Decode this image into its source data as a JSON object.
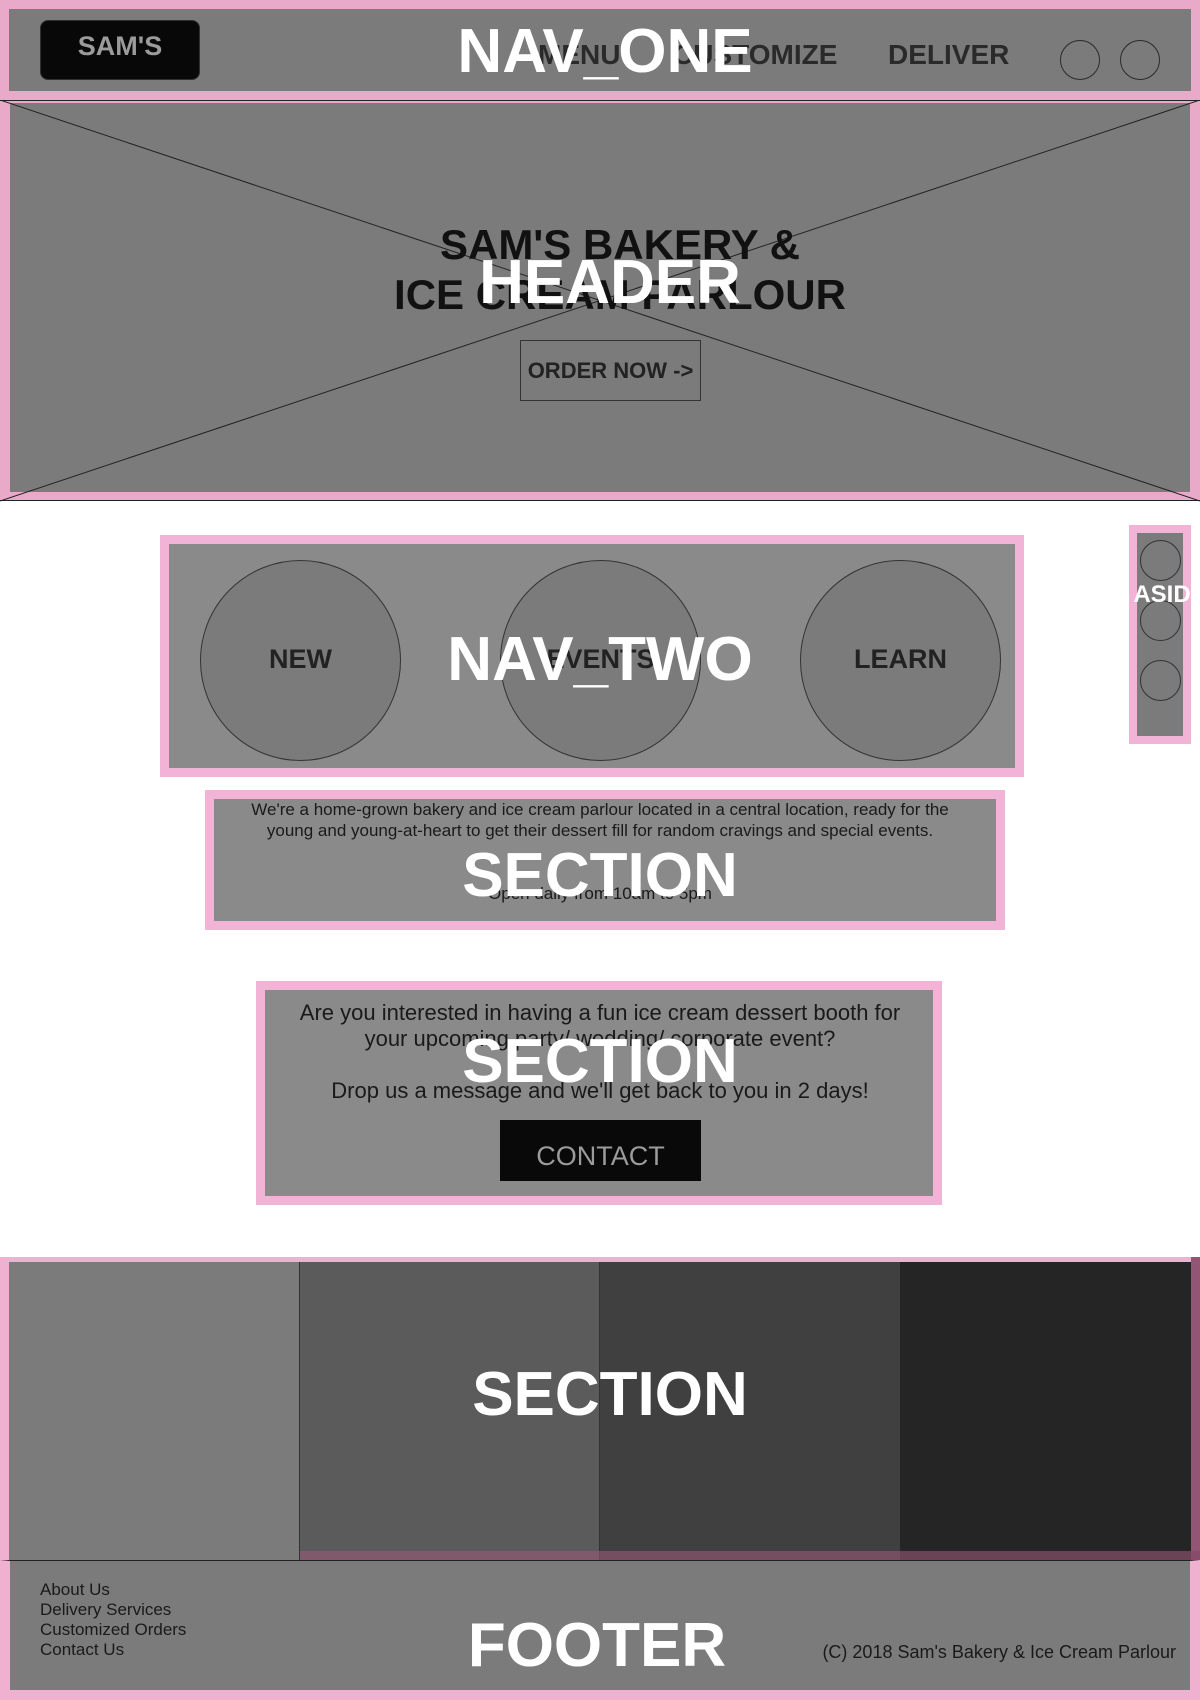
{
  "nav_one": {
    "label": "NAV_ONE",
    "logo_text": "SAM'S",
    "links": [
      "MENU",
      "CUSTOMIZE",
      "DELIVER"
    ]
  },
  "header": {
    "label": "HEADER",
    "title_line1": "SAM'S BAKERY &",
    "title_line2": "ICE CREAM PARLOUR",
    "cta": "ORDER NOW ->"
  },
  "nav_two": {
    "label": "NAV_TWO",
    "items": [
      "NEW",
      "EVENTS",
      "LEARN"
    ]
  },
  "aside": {
    "label": "ASIDE"
  },
  "section_about": {
    "label": "SECTION",
    "description": "We're a home-grown bakery and ice cream parlour located in a central location, ready for the young and young-at-heart to get their dessert fill for random cravings and special events.",
    "hours": "Open daily from 10am to 5pm"
  },
  "section_events": {
    "label": "SECTION",
    "question": "Are you interested in having a fun ice cream dessert booth for your upcoming party/ wedding/ corporate event?",
    "prompt": "Drop us a message and we'll get back to you in 2 days!",
    "button": "CONTACT"
  },
  "section_gallery": {
    "label": "SECTION",
    "column_colors": [
      "#7b7b7b",
      "#5b5b5b",
      "#404040",
      "#252525"
    ]
  },
  "footer": {
    "label": "FOOTER",
    "links": [
      "About Us",
      "Delivery Services",
      "Customized Orders",
      "Contact Us"
    ],
    "copyright": "(C) 2018 Sam's Bakery & Ice Cream Parlour"
  },
  "colors": {
    "region_outline": "#f2b4d6",
    "wireframe_fill": "#7b7b7b"
  }
}
